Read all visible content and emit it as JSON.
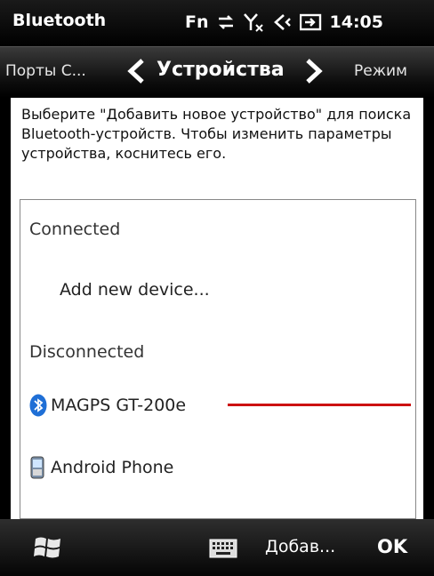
{
  "status_bar": {
    "app_title": "Bluetooth",
    "fn_label": "Fn",
    "clock": "14:05",
    "icons": [
      "sync-icon",
      "signal-off-icon",
      "volume-icon",
      "battery-charging-icon"
    ]
  },
  "tabs": {
    "prev_label": "Порты С...",
    "current_label": "Устройства",
    "next_label": "Режим"
  },
  "instructions": "Выберите \"Добавить новое устройство\" для поиска Bluetooth-устройств. Чтобы изменить параметры устройства, коснитесь его.",
  "device_list": {
    "connected_header": "Connected",
    "add_new_label": "Add new device...",
    "disconnected_header": "Disconnected",
    "devices": [
      {
        "name": "MAGPS GT-200e",
        "icon": "bluetooth-icon"
      },
      {
        "name": "Android Phone",
        "icon": "phone-icon"
      }
    ]
  },
  "softkeys": {
    "left_label": "Добав...",
    "right_label": "OK"
  },
  "colors": {
    "annotation_line": "#cc1111",
    "bluetooth_blue": "#1f6fd6"
  }
}
